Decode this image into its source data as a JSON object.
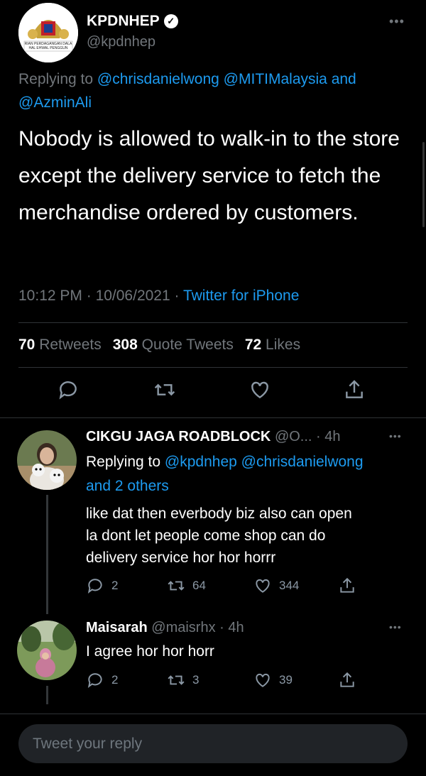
{
  "main_tweet": {
    "name": "KPDNHEP",
    "handle": "@kpdnhep",
    "replying_prefix": "Replying to",
    "replying_mentions": [
      "@chrisdanielwong",
      "@MITIMalaysia"
    ],
    "replying_and": "and",
    "replying_last": "@AzminAli",
    "text": "Nobody is allowed to walk-in to the store except the delivery service to fetch the merchandise ordered by customers.",
    "time": "10:12 PM",
    "date": "10/06/2021",
    "source": "Twitter for iPhone",
    "stats": {
      "retweets_count": "70",
      "retweets_label": "Retweets",
      "quotes_count": "308",
      "quotes_label": "Quote Tweets",
      "likes_count": "72",
      "likes_label": "Likes"
    },
    "logo_text": [
      "RIAN PERDAGANGAN DALA",
      "HAL EHWAL PENGGUN"
    ]
  },
  "replies": [
    {
      "name": "CIKGU JAGA ROADBLOCK",
      "handle": "@O...",
      "age": "· 4h",
      "replying_prefix": "Replying to",
      "replying_mentions": "@kpdnhep @chrisdanielwong",
      "replying_others": "and 2 others",
      "text_lines": [
        "like dat then everbody biz also can open",
        "la dont let people come shop can do",
        "delivery service hor hor horrr"
      ],
      "replies": "2",
      "retweets": "64",
      "likes": "344"
    },
    {
      "name": "Maisarah",
      "handle": "@maisrhx",
      "age": "· 4h",
      "text": "I agree hor hor horr",
      "replies": "2",
      "retweets": "3",
      "likes": "39"
    }
  ],
  "compose": {
    "placeholder": "Tweet your reply"
  },
  "colors": {
    "link": "#1d9bf0",
    "muted": "#71767b",
    "background": "#000000"
  }
}
